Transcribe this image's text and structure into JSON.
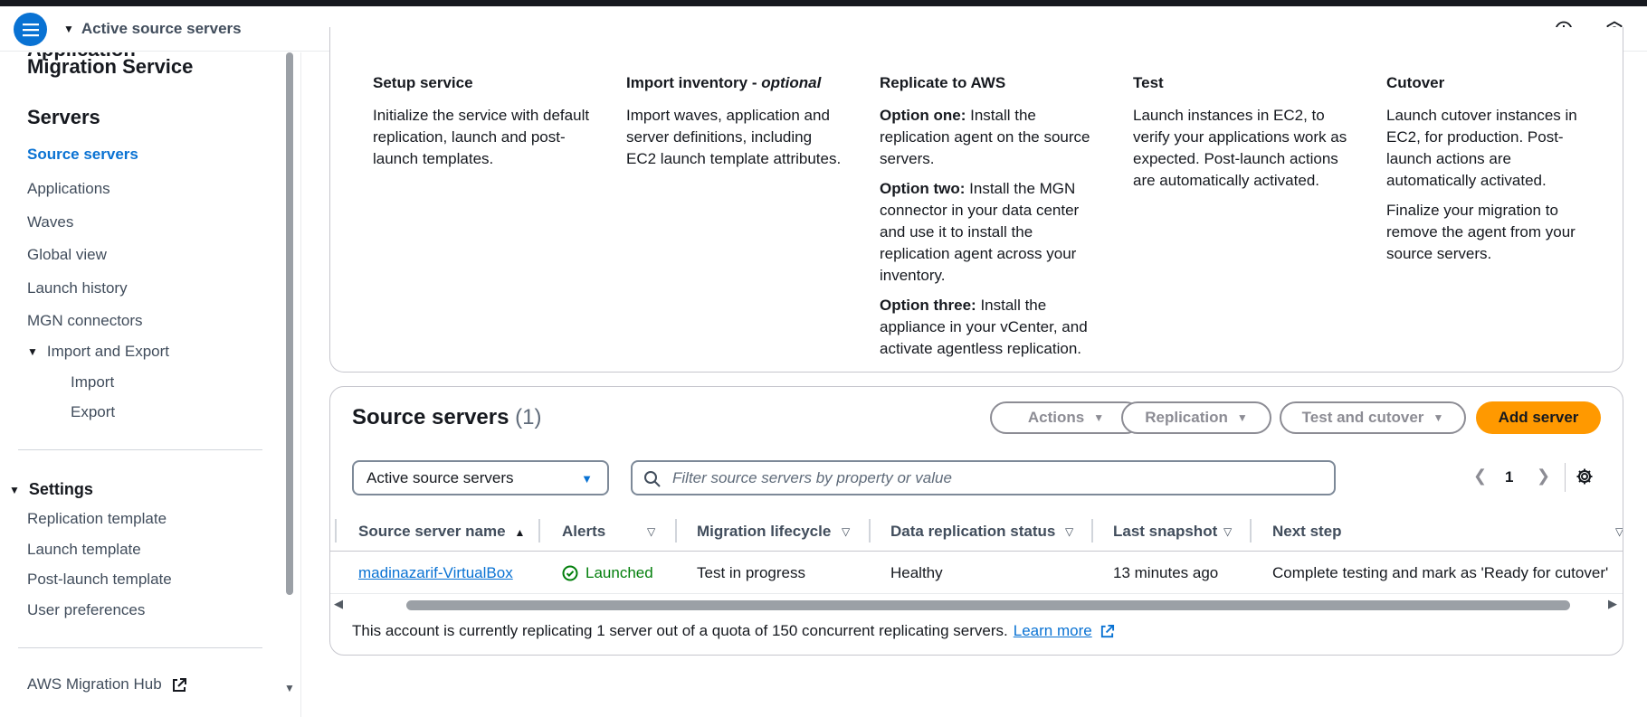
{
  "topbar": {
    "title": "Active source servers",
    "menu_icon": "hamburger-menu-icon",
    "info_icon": "info-icon",
    "notifications_icon": "settings-hex-icon"
  },
  "sidebar": {
    "service_title_cut": "Application",
    "service_title": "Migration Service",
    "servers_heading": "Servers",
    "items": [
      {
        "label": "Source servers",
        "active": true
      },
      {
        "label": "Applications"
      },
      {
        "label": "Waves"
      },
      {
        "label": "Global view"
      },
      {
        "label": "Launch history"
      },
      {
        "label": "MGN connectors"
      }
    ],
    "import_export": {
      "label": "Import and Export",
      "children": [
        "Import",
        "Export"
      ]
    },
    "settings": {
      "label": "Settings",
      "children": [
        "Replication template",
        "Launch template",
        "Post-launch template",
        "User preferences"
      ]
    },
    "migration_hub": "AWS Migration Hub"
  },
  "steps": [
    {
      "title": "Setup service",
      "paragraphs": [
        {
          "text": "Initialize the service with default replication, launch and post-launch templates."
        }
      ]
    },
    {
      "title": "Import inventory - ",
      "title_em": "optional",
      "paragraphs": [
        {
          "text": "Import waves, application and server definitions, including EC2 launch template attributes."
        }
      ]
    },
    {
      "title": "Replicate to AWS",
      "paragraphs": [
        {
          "bold": "Option one:",
          "text": " Install the replication agent on the source servers."
        },
        {
          "bold": "Option two:",
          "text": " Install the MGN connector in your data center and use it to install the replication agent across your inventory."
        },
        {
          "bold": "Option three:",
          "text": " Install the appliance in your vCenter, and activate agentless replication."
        }
      ]
    },
    {
      "title": "Test",
      "paragraphs": [
        {
          "text": "Launch instances in EC2, to verify your applications work as expected. Post-launch actions are automatically activated."
        }
      ]
    },
    {
      "title": "Cutover",
      "paragraphs": [
        {
          "text": "Launch cutover instances in EC2, for production. Post-launch actions are automatically activated."
        },
        {
          "text": "Finalize your migration to remove the agent from your source servers."
        }
      ]
    }
  ],
  "source_servers": {
    "title": "Source servers",
    "count": "(1)",
    "buttons": {
      "actions": "Actions",
      "replication": "Replication",
      "test_cutover": "Test and cutover",
      "add_server": "Add server"
    },
    "filter_select": "Active source servers",
    "search_placeholder": "Filter source servers by property or value",
    "page": "1",
    "columns": [
      "Source server name",
      "Alerts",
      "Migration lifecycle",
      "Data replication status",
      "Last snapshot",
      "Next step"
    ],
    "rows": [
      {
        "name": "madinazarif-VirtualBox",
        "alert": "Launched",
        "lifecycle": "Test in progress",
        "replication_status": "Healthy",
        "last_snapshot": "13 minutes ago",
        "next_step": "Complete testing and mark as 'Ready for cutover'"
      }
    ],
    "quota_note": "This account is currently replicating 1 server out of a quota of 150 concurrent replicating servers.",
    "learn_more": "Learn more"
  }
}
